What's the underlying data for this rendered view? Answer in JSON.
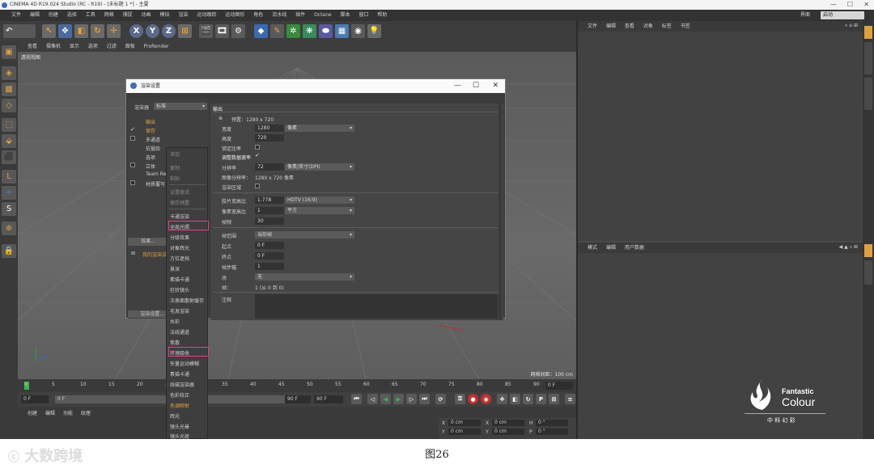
{
  "window": {
    "title": "CINEMA 4D R19.024 Studio (RC - R19) - [未标题 1 *] - 主要",
    "layout_label": "界面",
    "layout_value": "启动"
  },
  "menubar": [
    "文件",
    "编辑",
    "创建",
    "选择",
    "工具",
    "网格",
    "捕捉",
    "动画",
    "模拟",
    "渲染",
    "运动跟踪",
    "运动图形",
    "角色",
    "流水线",
    "插件",
    "Octane",
    "脚本",
    "窗口",
    "帮助"
  ],
  "toolbar": {
    "x_axis": "X",
    "y_axis": "Y",
    "z_axis": "Z"
  },
  "viewport": {
    "menu": [
      "查看",
      "摄像机",
      "显示",
      "选项",
      "过滤",
      "面板",
      "ProRender"
    ],
    "label": "透视视图",
    "grid_spacing": "网格间距：100 cm"
  },
  "object_manager": {
    "menu": [
      "文件",
      "编辑",
      "查看",
      "对象",
      "标签",
      "书签"
    ]
  },
  "attribute_manager": {
    "menu": [
      "模式",
      "编辑",
      "用户数据"
    ]
  },
  "timeline": {
    "ticks": [
      "0",
      "5",
      "10",
      "15",
      "20",
      "25",
      "30",
      "35",
      "40",
      "45",
      "50",
      "55",
      "60",
      "65",
      "70",
      "75",
      "80",
      "85",
      "90"
    ],
    "start_field": "0 F",
    "current_field": "0 F",
    "end_field": "90 F",
    "end_field2": "90 F",
    "right_field": "0 F"
  },
  "material_manager": {
    "menu": [
      "创建",
      "编辑",
      "功能",
      "纹理"
    ]
  },
  "coords": {
    "x1": "X",
    "y1": "Y",
    "x_val": "0 cm",
    "y_val": "0 cm",
    "x2": "X",
    "y2": "Y",
    "x2_val": "0 cm",
    "y2_val": "0 cm",
    "h": "H",
    "p": "P",
    "h_val": "0 °",
    "p_val": "0 °"
  },
  "render_settings": {
    "title": "渲染设置",
    "renderer_label": "渲染器",
    "renderer_value": "标准",
    "left_items": [
      "输出",
      "保存",
      "多通道",
      "抗锯齿",
      "选项",
      "立体",
      "Team Render",
      "材质覆写"
    ],
    "effect_button": "效果...",
    "multipass_button": "多通道渲染...",
    "my_settings": "我的渲染设置",
    "render_button": "渲染设置...",
    "section_title": "输出",
    "preset_label": "预置：1280 x 720",
    "width_label": "宽度",
    "width_value": "1280",
    "width_unit": "像素",
    "height_label": "高度",
    "height_value": "720",
    "lock_ratio_label": "锁定比率",
    "adapt_res_label": "调整数据速率",
    "resolution_label": "分辨率",
    "resolution_value": "72",
    "resolution_unit": "像素/英寸(DPI)",
    "image_res_label": "图像分辨率：",
    "image_res_value": "1280 x 720 像素",
    "render_region_label": "渲染区域",
    "film_ratio_label": "胶片宽高比",
    "film_ratio_value": "1.778",
    "film_ratio_preset": "HDTV (16:9)",
    "pixel_ratio_label": "像素宽高比",
    "pixel_ratio_value": "1",
    "pixel_ratio_preset": "平方",
    "fps_label": "帧频",
    "fps_value": "30",
    "frame_range_label": "帧范围",
    "frame_range_value": "当前帧",
    "start_label": "起点",
    "start_value": "0 F",
    "end_label": "终点",
    "end_value": "0 F",
    "step_label": "帧步幅",
    "step_value": "1",
    "field_label": "场",
    "field_value": "无",
    "frames_label": "帧：",
    "frames_value": "1 (从 0 到 0)",
    "notes_label": "注释"
  },
  "popup_menu": {
    "items": [
      {
        "label": "添加",
        "dim": true
      },
      {
        "label": "复制",
        "dim": true
      },
      {
        "label": "粘贴",
        "dim": true
      },
      {
        "label": "设置激活",
        "dim": true
      },
      {
        "label": "保存预置",
        "dim": true
      },
      {
        "label": "卡通渲染",
        "dim": false
      },
      {
        "label": "全局光照",
        "dim": false
      },
      {
        "label": "分级效果",
        "dim": false
      },
      {
        "label": "对象辉光",
        "dim": false
      },
      {
        "label": "方位遮挡",
        "dim": false
      },
      {
        "label": "景深",
        "dim": false
      },
      {
        "label": "素描卡通",
        "dim": false
      },
      {
        "label": "柱状镜头",
        "dim": false
      },
      {
        "label": "次表面散射缓存",
        "dim": false
      },
      {
        "label": "毛发渲染",
        "dim": false
      },
      {
        "label": "水彩",
        "dim": false
      },
      {
        "label": "法线通道",
        "dim": false
      },
      {
        "label": "焦散",
        "dim": false
      },
      {
        "label": "环境吸收",
        "dim": false
      },
      {
        "label": "矢量运动模糊",
        "dim": false
      },
      {
        "label": "素描卡通",
        "dim": false
      },
      {
        "label": "线描渲染器",
        "dim": false
      },
      {
        "label": "色彩校正",
        "dim": false
      },
      {
        "label": "色调映射",
        "dim": false
      },
      {
        "label": "辉光",
        "dim": false
      },
      {
        "label": "镜头光晕",
        "dim": false
      },
      {
        "label": "镜头光斑",
        "dim": false
      }
    ]
  },
  "logo": {
    "line1": "Fantastic",
    "line2": "Colour",
    "line3": "中 科 幻 彩"
  },
  "watermark": "大数跨境",
  "caption": "图26",
  "colors": {
    "highlight": "#e0408c",
    "ui_dark": "#3d3d3d",
    "title_blue": "#3b6db5"
  }
}
